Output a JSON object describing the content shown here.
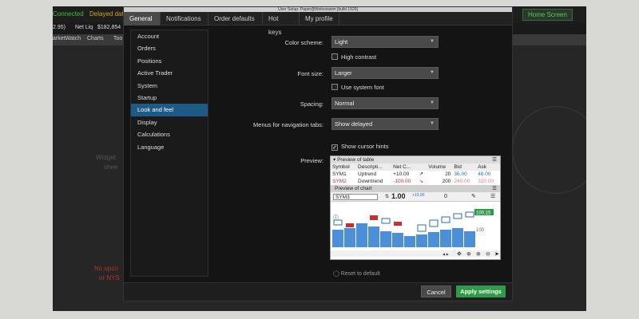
{
  "app": {
    "connected": "Connected",
    "delayed": "Delayed data",
    "home_screen": "Home Screen",
    "quotes": [
      "2.95)",
      "Net Liq",
      "$182,854"
    ],
    "tabs": [
      "arketWatch",
      "Charts",
      "Too"
    ],
    "ghost_widget": [
      "Widget",
      "shee"
    ],
    "ghost_red": [
      "No upco",
      "or NYS"
    ]
  },
  "dialog": {
    "title": "User Setup: Paper@thinkorswim [build 1929]",
    "tabs": [
      "General",
      "Notifications",
      "Order defaults",
      "Hot keys",
      "My profile"
    ],
    "sidebar": [
      "Account",
      "Orders",
      "Positions",
      "Active Trader",
      "System",
      "Startup",
      "Look and feel",
      "Display",
      "Calculations",
      "Language"
    ],
    "color_scheme": {
      "label": "Color scheme:",
      "value": "Light"
    },
    "high_contrast": "High contrast",
    "font_size": {
      "label": "Font size:",
      "value": "Larger"
    },
    "use_system_font": "Use system font",
    "spacing": {
      "label": "Spacing:",
      "value": "Normal"
    },
    "menus": {
      "label": "Menus for navigation tabs:",
      "value": "Show delayed"
    },
    "show_cursor_hints": "Show cursor hints",
    "preview_label": "Preview:",
    "reset_default": "Reset to default",
    "cancel": "Cancel",
    "apply": "Apply settings"
  },
  "preview": {
    "table_title": "Preview of table",
    "columns": [
      "Symbol",
      "Descripti...",
      "Net C...",
      "",
      "Volume",
      "Bid",
      "Ask"
    ],
    "rows": [
      {
        "symbol": "SYM1",
        "desc": "Uptrend",
        "net": "+10.00",
        "volume": "20",
        "bid": "36.00",
        "ask": "48.00"
      },
      {
        "symbol": "SYM2",
        "desc": "Downtrend",
        "net": "-100.00",
        "volume": "200",
        "bid": "240.00",
        "ask": "320.00"
      }
    ],
    "chart_title": "Preview of chart",
    "chart_symbol": "SYM3",
    "chart_qty": "1.00",
    "chart_pct": "+10.00",
    "chart_zero": "0",
    "price_tag": "100.15",
    "axis_value": "100"
  },
  "colors": {
    "accent_blue": "#1f5a86",
    "apply_green": "#2e9a4a",
    "up": "#4a8fd8",
    "down": "#c83030"
  }
}
